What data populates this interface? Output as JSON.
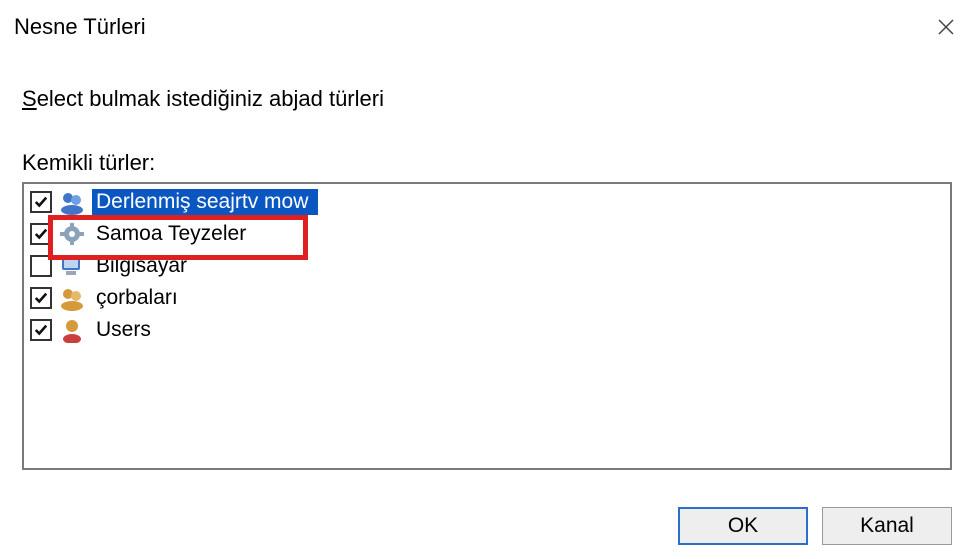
{
  "title": "Nesne Türleri",
  "prompt_underline": "S",
  "prompt_rest": "elect bulmak istediğiniz abjad türleri",
  "list_label": "Kemikli türler:",
  "items": [
    {
      "label": "Derlenmiş seajrtv mow",
      "checked": true,
      "selected": true,
      "icon": "group"
    },
    {
      "label": "Samoa Teyzeler",
      "checked": true,
      "selected": false,
      "icon": "gear"
    },
    {
      "label": "Bilgisayar",
      "checked": false,
      "selected": false,
      "icon": "computer"
    },
    {
      "label": "çorbaları",
      "checked": true,
      "selected": false,
      "icon": "group"
    },
    {
      "label": "Users",
      "checked": true,
      "selected": false,
      "icon": "user"
    }
  ],
  "buttons": {
    "ok": "OK",
    "cancel": "Kanal"
  }
}
